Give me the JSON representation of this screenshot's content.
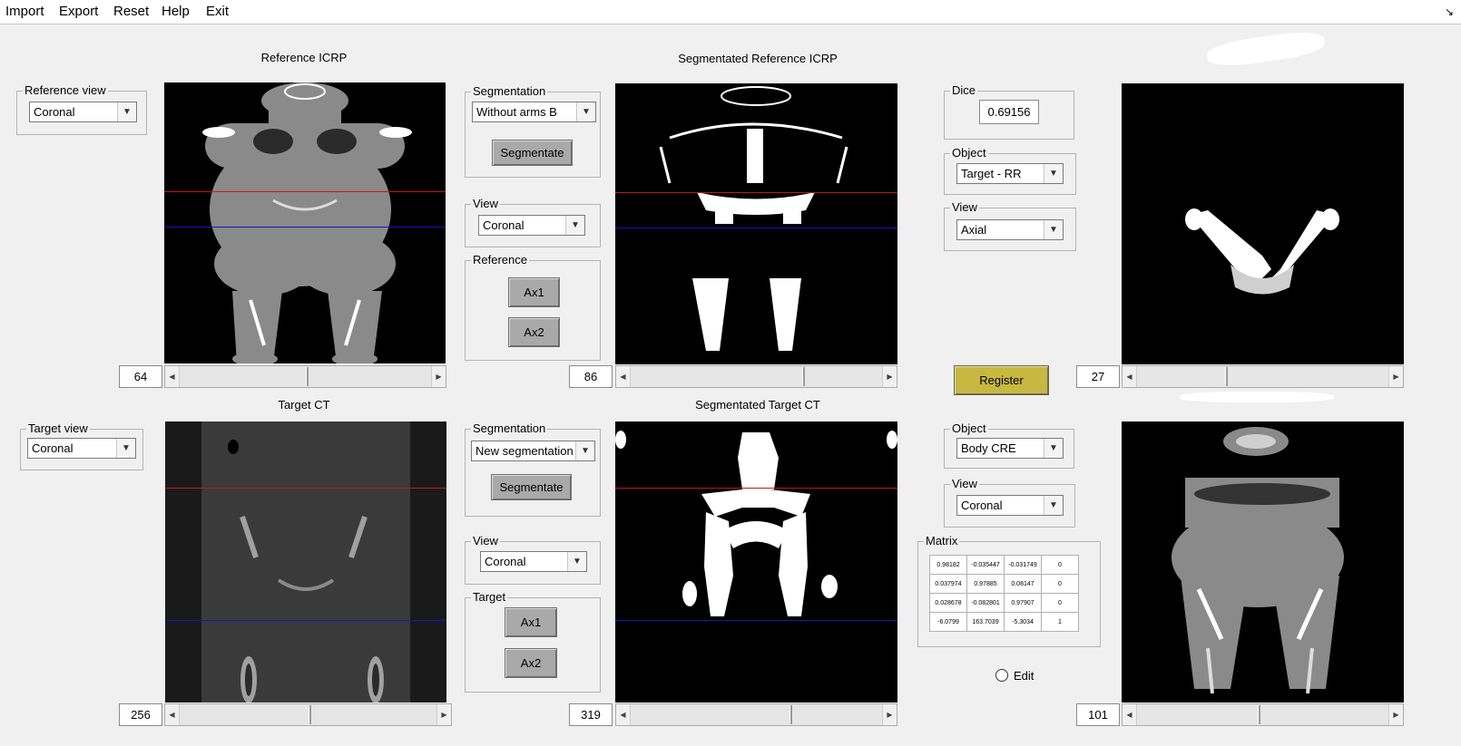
{
  "menu": [
    "Import",
    "Export",
    "Reset",
    "Help",
    "Exit"
  ],
  "icons": {
    "corner": "dock-arrow-icon"
  },
  "titles": {
    "reference": "Reference ICRP",
    "seg_reference": "Segmentated Reference ICRP",
    "target": "Target CT",
    "seg_target": "Segmentated Target CT"
  },
  "reference_view": {
    "label": "Reference view",
    "value": "Coronal"
  },
  "target_view": {
    "label": "Target view",
    "value": "Coronal"
  },
  "ref_segmentation": {
    "label": "Segmentation",
    "value": "Without arms B",
    "button": "Segmentate"
  },
  "ref_view": {
    "label": "View",
    "value": "Coronal"
  },
  "reference_group": {
    "label": "Reference",
    "ax1": "Ax1",
    "ax2": "Ax2"
  },
  "tgt_segmentation": {
    "label": "Segmentation",
    "value": "New segmentation",
    "button": "Segmentate"
  },
  "tgt_view": {
    "label": "View",
    "value": "Coronal"
  },
  "target_group": {
    "label": "Target",
    "ax1": "Ax1",
    "ax2": "Ax2"
  },
  "dice": {
    "label": "Dice",
    "value": "0.69156"
  },
  "object_top": {
    "label": "Object",
    "value": "Target - RR"
  },
  "view_top": {
    "label": "View",
    "value": "Axial"
  },
  "register_button": "Register",
  "object_bottom": {
    "label": "Object",
    "value": "Body CRE"
  },
  "view_bottom": {
    "label": "View",
    "value": "Coronal"
  },
  "matrix": {
    "label": "Matrix",
    "rows": [
      [
        "0.98182",
        "-0.035447",
        "-0.031749",
        "0"
      ],
      [
        "0.037974",
        "0.97885",
        "0.08147",
        "0"
      ],
      [
        "0.028678",
        "-0.082801",
        "0.97907",
        "0"
      ],
      [
        "-6.0799",
        "163.7039",
        "-5.3034",
        "1"
      ]
    ]
  },
  "edit_label": "Edit",
  "sliders": {
    "ref": {
      "value": "64",
      "fraction": 0.5
    },
    "seg_ref": {
      "value": "86",
      "fraction": 0.68
    },
    "reg_top": {
      "value": "27",
      "fraction": 0.35
    },
    "target": {
      "value": "256",
      "fraction": 0.5
    },
    "seg_target": {
      "value": "319",
      "fraction": 0.63
    },
    "reg_bottom": {
      "value": "101",
      "fraction": 0.48
    }
  },
  "colors": {
    "red_line": "#c81414",
    "blue_line": "#1414c8",
    "register": "#c7b83f"
  }
}
